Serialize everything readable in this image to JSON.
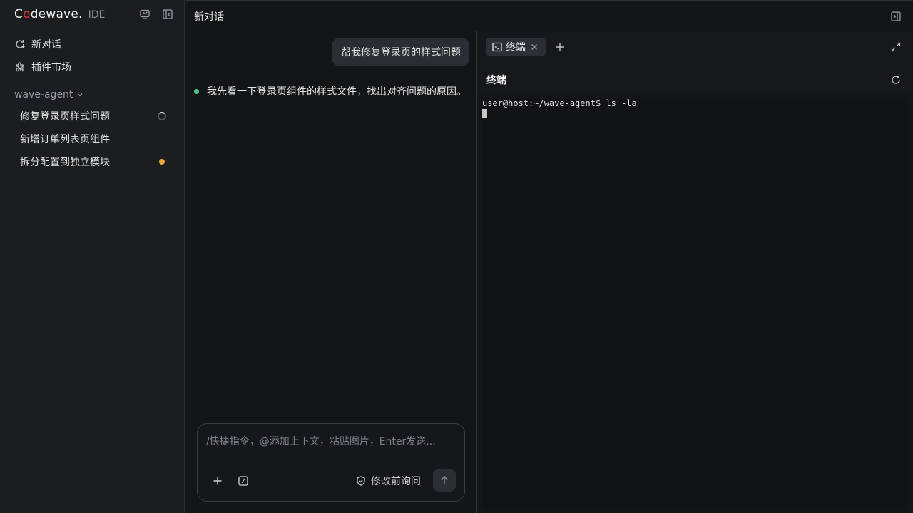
{
  "app": {
    "brand_prefix": "C",
    "brand_o": "o",
    "brand_suffix": "dewave",
    "brand_dot": ".",
    "brand_sub": "IDE"
  },
  "sidebar": {
    "nav": [
      {
        "label": "新对话",
        "icon": "new-chat-icon"
      },
      {
        "label": "插件市场",
        "icon": "puzzle-icon"
      }
    ],
    "workspace": "wave-agent",
    "sessions": [
      {
        "label": "修复登录页样式问题",
        "status": "running"
      },
      {
        "label": "新增订单列表页组件",
        "status": "idle"
      },
      {
        "label": "拆分配置到独立模块",
        "status": "pending"
      }
    ]
  },
  "header": {
    "title": "新对话"
  },
  "chat": {
    "user_message": "帮我修复登录页的样式问题",
    "assistant_message": "我先看一下登录页组件的样式文件，找出对齐问题的原因。",
    "composer": {
      "placeholder": "/快捷指令，@添加上下文，粘贴图片，Enter发送...",
      "mode_label": "修改前询问"
    }
  },
  "terminal": {
    "tab_label": "终端",
    "panel_title": "终端",
    "lines": [
      "user@host:~/wave-agent$ ls -la"
    ]
  },
  "colors": {
    "accent_logo": "#e03a3a",
    "status_running": "#dcdcdc",
    "status_pending": "#e9a93a",
    "assistant_dot": "#4cc38a"
  }
}
